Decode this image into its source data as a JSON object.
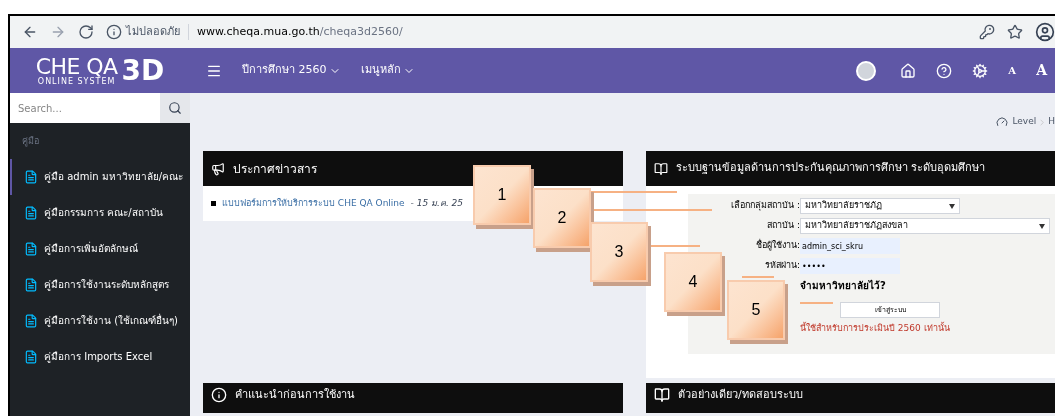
{
  "browser": {
    "security": "ไม่ปลอดภัย",
    "url_host": "www.cheqa.mua.go.th",
    "url_path": "/cheqa3d2560/"
  },
  "header": {
    "logo": "CHE QA",
    "logo_mark": "3D",
    "logo_sub": "ONLINE SYSTEM",
    "menus": [
      {
        "label": "ปีการศึกษา 2560"
      },
      {
        "label": "เมนูหลัก"
      }
    ],
    "font_small": "A",
    "font_large": "A"
  },
  "sidebar": {
    "search": {
      "placeholder": "Search..."
    },
    "section": "คู่มือ",
    "items": [
      {
        "label": "คู่มือ admin มหาวิทยาลัย/คณะ",
        "selected": true
      },
      {
        "label": "คู่มือกรรมการ คณะ/สถาบัน",
        "selected": false
      },
      {
        "label": "คู่มือการเพิ่มอัตลักษณ์",
        "selected": false
      },
      {
        "label": "คู่มือการใช้งานระดับหลักสูตร",
        "selected": false
      },
      {
        "label": "คู่มือการใช้งาน (ใช้เกณฑ์อื่นๆ)",
        "selected": false
      },
      {
        "label": "คู่มือการ Imports Excel",
        "selected": false
      }
    ]
  },
  "breadcrumb": [
    "Level",
    "H"
  ],
  "news": {
    "title": "ประกาศข่าวสาร",
    "items": [
      {
        "link": "แบบฟอร์มการให้บริการระบบ CHE QA Online",
        "date": " - 15 ม.ค. 25"
      }
    ]
  },
  "login": {
    "title": "ระบบฐานข้อมูลด้านการประกันคุณภาพการศึกษา ระดับอุดมศึกษา",
    "group_label": "เลือกกลุ่มสถาบัน :",
    "group_value": "มหาวิทยาลัยราชภัฏ",
    "institution_label": "สถาบัน :",
    "institution_value": "มหาวิทยาลัยราชภัฏสงขลา",
    "username_label": "ชื่อผู้ใช้งาน:",
    "username_value": "admin_sci_skru",
    "password_label": "รหัสผ่าน:",
    "password_value": "•••••",
    "remember": "จำมหาวิทยาลัยไว้?",
    "submit": "เข้าสู่ระบบ",
    "note": "นี้ใช้สำหรับการประเมินปี 2560 เท่านั้น"
  },
  "bottom_panels": [
    {
      "title": "คำแนะนำก่อนการใช้งาน",
      "kind": "info"
    },
    {
      "title": "ตัวอย่างเดียว/ทดสอบระบบ",
      "kind": "book"
    }
  ],
  "callouts": [
    "1",
    "2",
    "3",
    "4",
    "5"
  ]
}
